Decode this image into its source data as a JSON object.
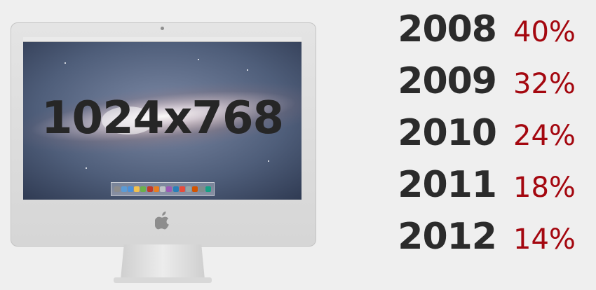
{
  "device": {
    "resolution_label": "1024x768",
    "dock_icon_colors": [
      "#8c8c8c",
      "#5b9bd5",
      "#4a90d9",
      "#f2c14e",
      "#6ab04c",
      "#c0392b",
      "#e67e22",
      "#bdc3c7",
      "#9b59b6",
      "#2980b9",
      "#e74c3c",
      "#95a5a6",
      "#d35400",
      "#7f8c8d",
      "#16a085"
    ]
  },
  "stats": [
    {
      "year": "2008",
      "percent": "40%"
    },
    {
      "year": "2009",
      "percent": "32%"
    },
    {
      "year": "2010",
      "percent": "24%"
    },
    {
      "year": "2011",
      "percent": "18%"
    },
    {
      "year": "2012",
      "percent": "14%"
    }
  ],
  "colors": {
    "year": "#2b2b2b",
    "percent": "#a4070f",
    "background": "#efefef"
  }
}
